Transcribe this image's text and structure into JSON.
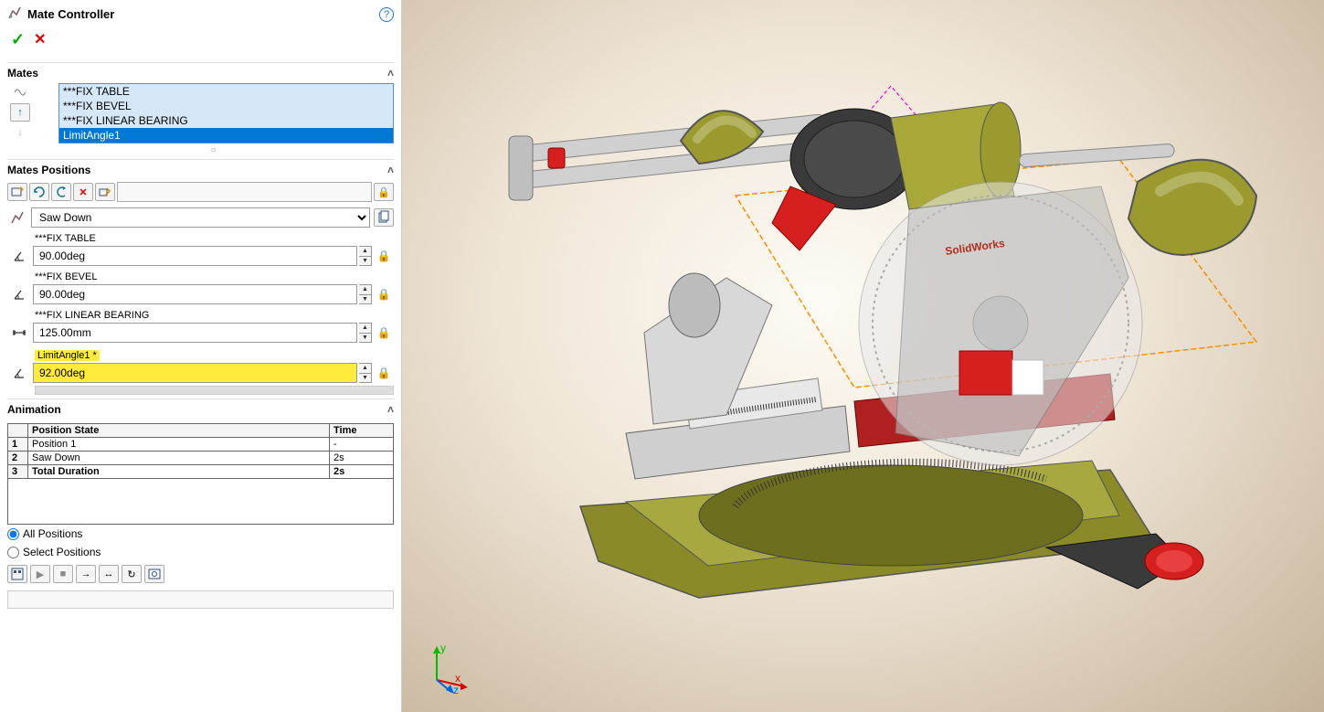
{
  "header": {
    "title": "Mate Controller"
  },
  "sections": {
    "mates_label": "Mates",
    "mates_positions_label": "Mates Positions",
    "animation_label": "Animation"
  },
  "mates_list": {
    "items": [
      "***FIX TABLE",
      "***FIX BEVEL",
      "***FIX LINEAR BEARING",
      "LimitAngle1"
    ],
    "selected_index": 3
  },
  "position_selector": {
    "value": "Saw Down"
  },
  "mate_fields": [
    {
      "label": "***FIX TABLE",
      "value": "90.00deg",
      "icon": "angle",
      "highlight": false
    },
    {
      "label": "***FIX BEVEL",
      "value": "90.00deg",
      "icon": "angle",
      "highlight": false
    },
    {
      "label": "***FIX LINEAR BEARING",
      "value": "125.00mm",
      "icon": "distance",
      "highlight": false
    },
    {
      "label": "LimitAngle1 *",
      "value": "92.00deg",
      "icon": "angle",
      "highlight": true
    }
  ],
  "animation": {
    "headers": {
      "state": "Position State",
      "time": "Time"
    },
    "rows": [
      {
        "n": "1",
        "state": "Position 1",
        "time": "-"
      },
      {
        "n": "2",
        "state": "Saw Down",
        "time": "2s"
      },
      {
        "n": "3",
        "state": "Total Duration",
        "time": "2s",
        "bold": true
      }
    ],
    "radio": {
      "all": "All Positions",
      "select": "Select Positions"
    }
  },
  "viewport": {
    "axes": {
      "x": "x",
      "y": "y",
      "z": "z"
    },
    "model_label": "SolidWorks"
  }
}
